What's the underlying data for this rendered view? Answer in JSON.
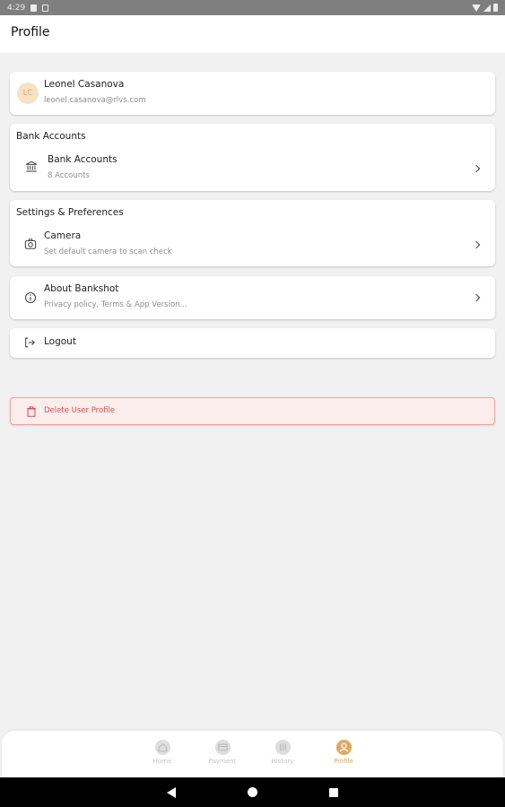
{
  "status_bar": {
    "time": "4:29"
  },
  "header": {
    "title": "Profile"
  },
  "user": {
    "initials": "LC",
    "name": "Leonel Casanova",
    "email": "leonel.casanova@rlvs.com"
  },
  "bank_section": {
    "title": "Bank Accounts",
    "row": {
      "label": "Bank Accounts",
      "sub": "8 Accounts",
      "icon": "bank-icon"
    }
  },
  "settings_section": {
    "title": "Settings & Preferences",
    "row": {
      "label": "Camera",
      "sub": "Set default camera to scan check",
      "icon": "camera-icon"
    }
  },
  "about": {
    "label": "About Bankshot",
    "sub": "Privacy policy, Terms & App Version...",
    "icon": "info-icon"
  },
  "logout": {
    "label": "Logout",
    "icon": "logout-icon"
  },
  "delete": {
    "label": "Delete User Profile",
    "icon": "trash-icon"
  },
  "bottom_nav": {
    "items": [
      {
        "label": "Home",
        "icon": "home-icon",
        "active": false
      },
      {
        "label": "Payment",
        "icon": "payment-icon",
        "active": false
      },
      {
        "label": "History",
        "icon": "history-icon",
        "active": false
      },
      {
        "label": "Profile",
        "icon": "profile-icon",
        "active": true
      }
    ]
  },
  "colors": {
    "accent": "#e0a860",
    "danger": "#e24b4b",
    "danger_bg": "#fdeeee",
    "background": "#f1f1f1"
  }
}
